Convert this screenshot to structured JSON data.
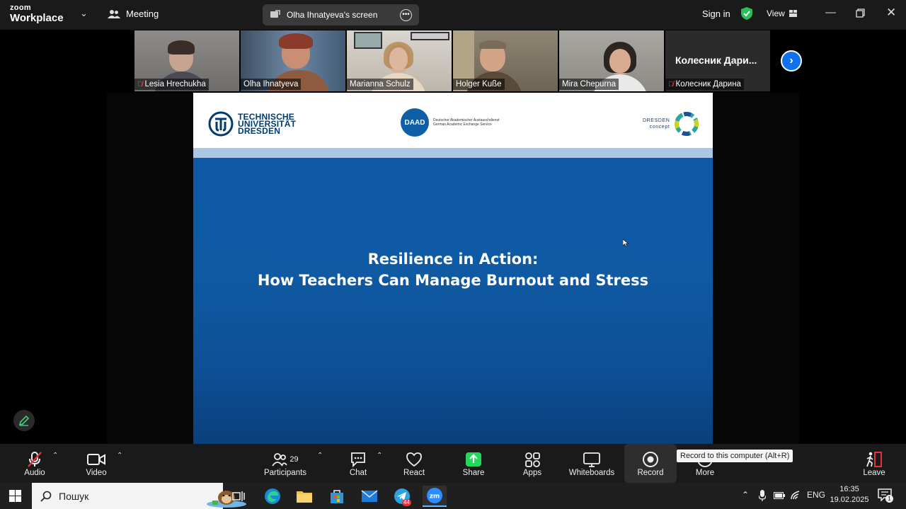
{
  "app": {
    "brand_top": "zoom",
    "brand_bottom": "Workplace",
    "meeting_label": "Meeting",
    "screen_label": "Olha Ihnatyeva's screen",
    "sign_in": "Sign in",
    "view": "View"
  },
  "participants_strip": [
    {
      "name": "Lesia Hrechukha",
      "muted": true
    },
    {
      "name": "Olha Ihnatyeva",
      "muted": false,
      "active_speaker": true
    },
    {
      "name": "Marianna Schulz",
      "muted": false
    },
    {
      "name": "Holger Kuße",
      "muted": false
    },
    {
      "name": "Mira Chepurna",
      "muted": false
    },
    {
      "name": "Колесник Дарина",
      "display_name": "Колесник  Дари...",
      "muted": true
    }
  ],
  "slide": {
    "logo_tud": [
      "TECHNISCHE",
      "UNIVERSITÄT",
      "DRESDEN"
    ],
    "logo_daad": "DAAD",
    "logo_daad_sub": [
      "Deutscher Akademischer Austauschdienst",
      "German Academic Exchange Service"
    ],
    "logo_dresden": [
      "DRESDEN",
      "concept"
    ],
    "title_line1": "Resilience in Action:",
    "title_line2": "How Teachers Can Manage Burnout and Stress"
  },
  "toolbar": {
    "audio": "Audio",
    "video": "Video",
    "participants": "Participants",
    "participants_count": "29",
    "chat": "Chat",
    "react": "React",
    "share": "Share",
    "apps": "Apps",
    "whiteboards": "Whiteboards",
    "record": "Record",
    "more": "More",
    "leave": "Leave",
    "record_tooltip": "Record to this computer (Alt+R)"
  },
  "taskbar": {
    "search_placeholder": "Пошук",
    "telegram_badge": "44",
    "lang": "ENG",
    "time": "16:35",
    "date": "19.02.2025",
    "notifications": "1"
  },
  "colors": {
    "zoom_blue": "#0e72ed",
    "share_green": "#23d959",
    "active_outline": "#34c759",
    "slide_blue": "#0e58a6"
  }
}
